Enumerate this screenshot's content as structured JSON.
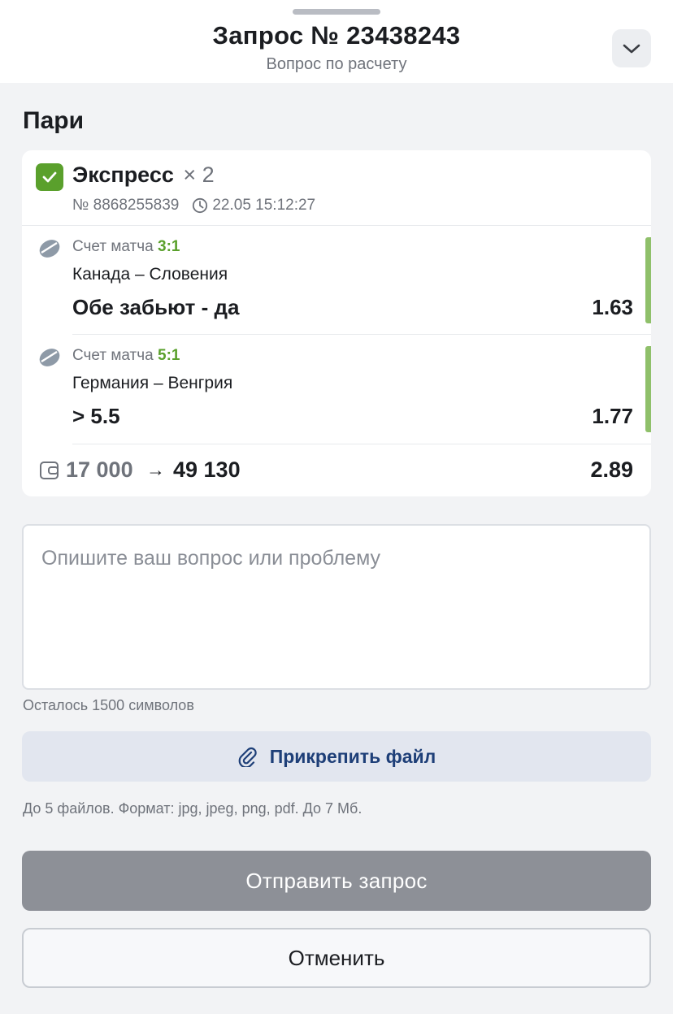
{
  "header": {
    "title": "Запрос № 23438243",
    "subtitle": "Вопрос по расчету",
    "collapse_icon": "chevron-down-icon"
  },
  "section": {
    "title": "Пари"
  },
  "bet": {
    "type": "Экспресс",
    "multiplier": "× 2",
    "number": "№ 8868255839",
    "datetime": "22.05 15:12:27",
    "accent_color": "#5aa02c",
    "events": [
      {
        "score_label": "Счет матча",
        "score": "3:1",
        "teams": "Канада – Словения",
        "market": "Обе забьют - да",
        "odd": "1.63",
        "icon": "hockey-puck-icon"
      },
      {
        "score_label": "Счет матча",
        "score": "5:1",
        "teams": "Германия – Венгрия",
        "market": "> 5.5",
        "odd": "1.77",
        "icon": "hockey-puck-icon"
      }
    ],
    "stake": "17 000",
    "arrow": "→",
    "payout": "49 130",
    "total_odd": "2.89"
  },
  "form": {
    "placeholder": "Опишите ваш вопрос или проблему",
    "chars_left": "Осталось 1500 символов",
    "attach_label": "Прикрепить файл",
    "file_hint": "До 5 файлов. Формат: jpg, jpeg, png, pdf. До 7 Мб.",
    "submit_label": "Отправить запрос",
    "cancel_label": "Отменить"
  }
}
